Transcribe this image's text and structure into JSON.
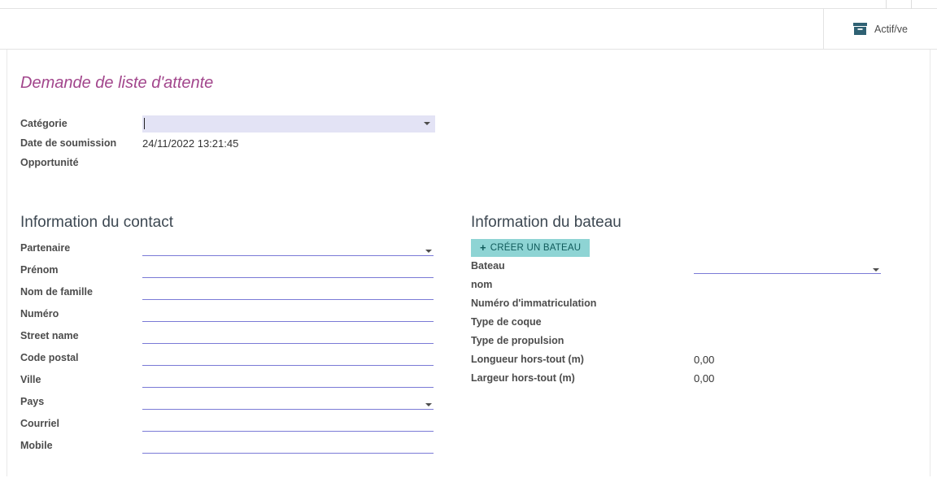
{
  "statusbar": {
    "active_label": "Actif/ve"
  },
  "sheet": {
    "title": "Demande de liste d'attente",
    "general": {
      "categorie_label": "Catégorie",
      "date_label": "Date de soumission",
      "date_value": "24/11/2022 13:21:45",
      "opportunite_label": "Opportunité"
    },
    "contact": {
      "heading": "Information du contact",
      "fields": [
        {
          "label": "Partenaire",
          "dropdown": true
        },
        {
          "label": "Prénom",
          "dropdown": false
        },
        {
          "label": "Nom de famille",
          "dropdown": false
        },
        {
          "label": "Numéro",
          "dropdown": false
        },
        {
          "label": "Street name",
          "dropdown": false
        },
        {
          "label": "Code postal",
          "dropdown": false
        },
        {
          "label": "Ville",
          "dropdown": false
        },
        {
          "label": "Pays",
          "dropdown": true
        },
        {
          "label": "Courriel",
          "dropdown": false
        },
        {
          "label": "Mobile",
          "dropdown": false
        }
      ]
    },
    "bateau": {
      "heading": "Information du bateau",
      "create_button_label": "CRÉER UN BATEAU",
      "fields": [
        {
          "label": "Bateau",
          "value": "",
          "dropdown": true
        },
        {
          "label": "nom",
          "value": ""
        },
        {
          "label": "Numéro d'immatriculation",
          "value": ""
        },
        {
          "label": "Type de coque",
          "value": ""
        },
        {
          "label": "Type de propulsion",
          "value": ""
        },
        {
          "label": "Longueur hors-tout (m)",
          "value": "0,00"
        },
        {
          "label": "Largeur hors-tout (m)",
          "value": "0,00"
        }
      ]
    }
  },
  "icons": {
    "plus": "+"
  },
  "colors": {
    "title_purple": "#a2468c",
    "field_underline": "#7a7ad6",
    "focused_input_bg": "#e3e3f5",
    "create_button_bg": "#8ed4d4",
    "create_button_text": "#0f5a5a",
    "archive_icon": "#2f6173",
    "label_text": "#4c4c4c"
  }
}
